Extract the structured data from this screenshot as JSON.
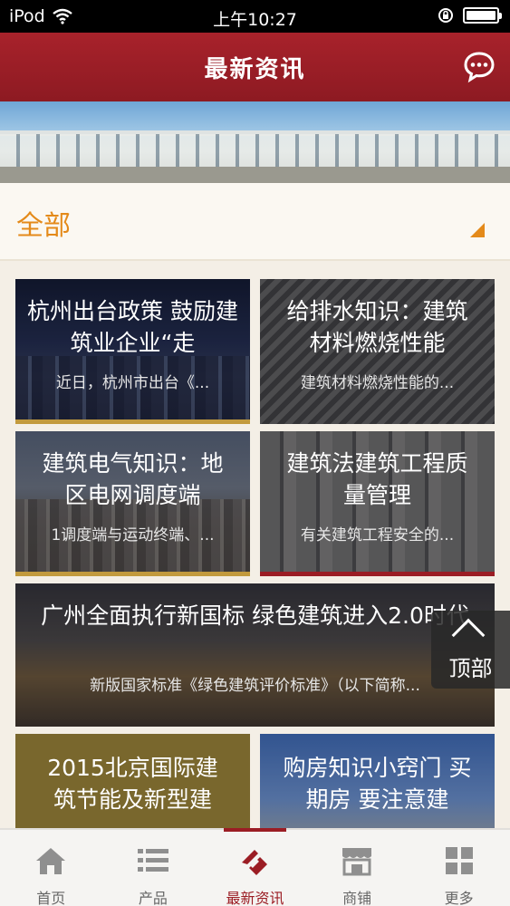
{
  "status": {
    "device": "iPod",
    "time": "上午10:27"
  },
  "header": {
    "title": "最新资讯",
    "message_icon": "chat-bubble-icon"
  },
  "banner": {
    "slide_count": 1,
    "active_slide": 1
  },
  "category": {
    "label": "全部"
  },
  "articles": [
    {
      "title": "杭州出台政策 鼓励建筑业企业“走",
      "summary": "近日，杭州市出台《..."
    },
    {
      "title": "给排水知识：建筑材料燃烧性能",
      "summary": "建筑材料燃烧性能的..."
    },
    {
      "title": "建筑电气知识：地区电网调度端",
      "summary": "1调度端与运动终端、..."
    },
    {
      "title": "建筑法建筑工程质量管理",
      "summary": "有关建筑工程安全的..."
    },
    {
      "title": "广州全面执行新国标 绿色建筑进入2.0时代",
      "summary": "新版国家标准《绿色建筑评价标准》（以下简称..."
    },
    {
      "title": "2015北京国际建筑节能及新型建",
      "summary": ""
    },
    {
      "title": "购房知识小窍门 买期房 要注意建",
      "summary": ""
    }
  ],
  "top_button": {
    "label": "顶部"
  },
  "tabs": [
    {
      "label": "首页",
      "icon": "home-icon"
    },
    {
      "label": "产品",
      "icon": "list-icon"
    },
    {
      "label": "最新资讯",
      "icon": "news-icon"
    },
    {
      "label": "商铺",
      "icon": "store-icon"
    },
    {
      "label": "更多",
      "icon": "grid-icon"
    }
  ],
  "colors": {
    "primary": "#9b1d24",
    "accent": "#e48a1a",
    "indicator": "#f39100"
  }
}
